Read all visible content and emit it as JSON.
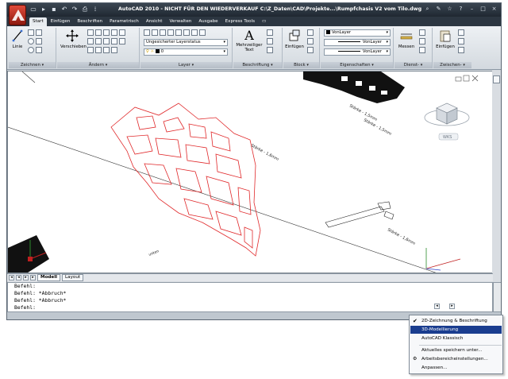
{
  "title_bar": {
    "title": "AutoCAD 2010 - NICHT FÜR DEN WIEDERVERKAUF   C:\\Z_Daten\\CAD\\Projekte...\\Rumpfchasis V2 vom Tilo.dwg"
  },
  "ribbon": {
    "tabs": [
      "Start",
      "Einfügen",
      "Beschriften",
      "Parametrisch",
      "Ansicht",
      "Verwalten",
      "Ausgabe",
      "Express Tools"
    ],
    "active_tab": "Start",
    "panels": {
      "zeichnen": {
        "title": "Zeichnen",
        "linie_label": "Linie"
      },
      "aendern": {
        "title": "Ändern",
        "verschieben_label": "Verschieben"
      },
      "layer": {
        "title": "Layer",
        "layer_status": "Ungesicherter Layerstatus",
        "current_layer": "0"
      },
      "beschriftung": {
        "title": "Beschriftung",
        "mtext_label_1": "Mehrzeiliger",
        "mtext_label_2": "Text"
      },
      "block": {
        "title": "Block",
        "einfuegen_label": "Einfügen"
      },
      "eigenschaften": {
        "title": "Eigenschaften",
        "color": "VonLayer",
        "linetype": "VonLayer",
        "lineweight": "VonLayer"
      },
      "dienst": {
        "title": "Dienst-",
        "messen_label": "Messen"
      },
      "zwischen": {
        "title": "Zwischen-",
        "einfuegen_label": "Einfügen"
      }
    }
  },
  "drawing": {
    "wcs_label": "WKS",
    "annotations": {
      "top": "Stärke - 1,5mm",
      "bracket": "Stärke - 1,5mm",
      "main": "Stärke - 1,6mm",
      "small": "Stärke - 1,6mm",
      "bottom": "unten"
    }
  },
  "layout_tabs": [
    "Modell",
    "Layout"
  ],
  "active_layout": "Modell",
  "command_line": {
    "lines": [
      "Befehl:",
      "Befehl: *Abbruch*",
      "Befehl: *Abbruch*",
      "Befehl:"
    ]
  },
  "workspace_menu": {
    "items": [
      {
        "label": "2D-Zeichnung & Beschriftung",
        "checked": true
      },
      {
        "label": "3D-Modellierung",
        "selected": true
      },
      {
        "label": "AutoCAD Klassisch"
      },
      {
        "label": "Aktuelles speichern unter..."
      },
      {
        "label": "Arbeitsbereicheinstellungen..."
      },
      {
        "label": "Anpassen..."
      }
    ]
  },
  "colors": {
    "title_bar": "#1f2831",
    "tab_bar": "#2c3641",
    "part_outline": "#e0282a",
    "menu_highlight": "#1a3d8f"
  }
}
